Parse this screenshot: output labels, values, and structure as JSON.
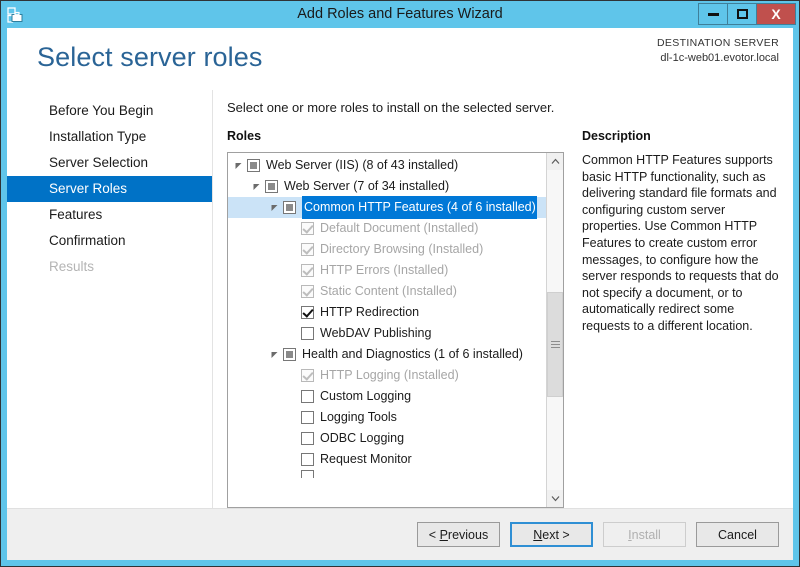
{
  "window": {
    "title": "Add Roles and Features Wizard",
    "icon": "server-wizard-icon",
    "minimize_label": "Minimize",
    "maximize_label": "Maximize",
    "close_label": "X",
    "accent_color": "#5fc5ea",
    "close_color": "#c0504d"
  },
  "header": {
    "page_title": "Select server roles",
    "destination_label": "DESTINATION SERVER",
    "destination_value": "dl-1c-web01.evotor.local"
  },
  "nav": {
    "items": [
      {
        "label": "Before You Begin",
        "state": "normal"
      },
      {
        "label": "Installation Type",
        "state": "normal"
      },
      {
        "label": "Server Selection",
        "state": "normal"
      },
      {
        "label": "Server Roles",
        "state": "selected"
      },
      {
        "label": "Features",
        "state": "normal"
      },
      {
        "label": "Confirmation",
        "state": "normal"
      },
      {
        "label": "Results",
        "state": "disabled"
      }
    ],
    "selected_color": "#0072c6"
  },
  "main": {
    "instruction": "Select one or more roles to install on the selected server.",
    "roles_header": "Roles",
    "description_header": "Description",
    "description_text": "Common HTTP Features supports basic HTTP functionality, such as delivering standard file formats and configuring custom server properties. Use Common HTTP Features to create custom error messages, to configure how the server responds to requests that do not specify a document, or to automatically redirect some requests to a different location."
  },
  "tree": {
    "rows": [
      {
        "label": "Web Server (IIS) (8 of 43 installed)",
        "indent": 0,
        "expander": "expanded",
        "checkbox": "partial",
        "dim": false,
        "selected": false
      },
      {
        "label": "Web Server (7 of 34 installed)",
        "indent": 1,
        "expander": "expanded",
        "checkbox": "partial",
        "dim": false,
        "selected": false
      },
      {
        "label": "Common HTTP Features (4 of 6 installed)",
        "indent": 2,
        "expander": "expanded",
        "checkbox": "partial",
        "dim": false,
        "selected": true
      },
      {
        "label": "Default Document (Installed)",
        "indent": 3,
        "expander": "none",
        "checkbox": "checked-disabled",
        "dim": true,
        "selected": false
      },
      {
        "label": "Directory Browsing (Installed)",
        "indent": 3,
        "expander": "none",
        "checkbox": "checked-disabled",
        "dim": true,
        "selected": false
      },
      {
        "label": "HTTP Errors (Installed)",
        "indent": 3,
        "expander": "none",
        "checkbox": "checked-disabled",
        "dim": true,
        "selected": false
      },
      {
        "label": "Static Content (Installed)",
        "indent": 3,
        "expander": "none",
        "checkbox": "checked-disabled",
        "dim": true,
        "selected": false
      },
      {
        "label": "HTTP Redirection",
        "indent": 3,
        "expander": "none",
        "checkbox": "checked",
        "dim": false,
        "selected": false
      },
      {
        "label": "WebDAV Publishing",
        "indent": 3,
        "expander": "none",
        "checkbox": "empty",
        "dim": false,
        "selected": false
      },
      {
        "label": "Health and Diagnostics (1 of 6 installed)",
        "indent": 2,
        "expander": "expanded",
        "checkbox": "partial",
        "dim": false,
        "selected": false
      },
      {
        "label": "HTTP Logging (Installed)",
        "indent": 3,
        "expander": "none",
        "checkbox": "checked-disabled",
        "dim": true,
        "selected": false
      },
      {
        "label": "Custom Logging",
        "indent": 3,
        "expander": "none",
        "checkbox": "empty",
        "dim": false,
        "selected": false
      },
      {
        "label": "Logging Tools",
        "indent": 3,
        "expander": "none",
        "checkbox": "empty",
        "dim": false,
        "selected": false
      },
      {
        "label": "ODBC Logging",
        "indent": 3,
        "expander": "none",
        "checkbox": "empty",
        "dim": false,
        "selected": false
      },
      {
        "label": "Request Monitor",
        "indent": 3,
        "expander": "none",
        "checkbox": "empty",
        "dim": false,
        "selected": false
      },
      {
        "label": "",
        "indent": 3,
        "expander": "none",
        "checkbox": "empty",
        "dim": false,
        "selected": false,
        "clipped": true
      }
    ],
    "scrollbar": {
      "up_arrow": "▲",
      "down_arrow": "▼",
      "thumb_top_pct": 38,
      "thumb_height_pct": 33
    }
  },
  "footer": {
    "buttons": [
      {
        "label": "< Previous",
        "accesskey": "P",
        "state": "normal"
      },
      {
        "label": "Next >",
        "accesskey": "N",
        "state": "focused"
      },
      {
        "label": "Install",
        "accesskey": "I",
        "state": "disabled"
      },
      {
        "label": "Cancel",
        "accesskey": "",
        "state": "normal"
      }
    ]
  }
}
